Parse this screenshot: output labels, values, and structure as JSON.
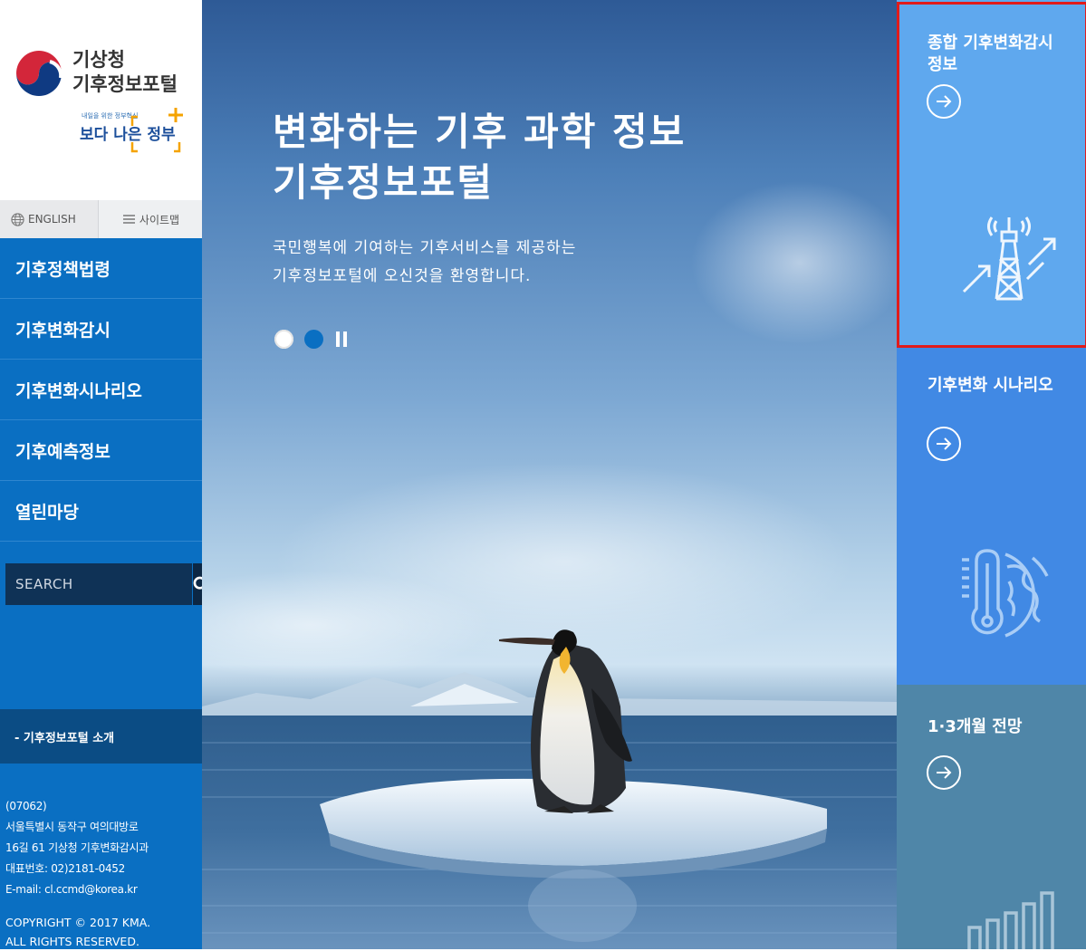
{
  "logo": {
    "line1": "기상청",
    "line2": "기후정보포털",
    "gov_small": "내일을 위한 정부혁신",
    "gov_main": "보다 나은 정부"
  },
  "util": {
    "english": "ENGLISH",
    "sitemap": "사이트맵"
  },
  "nav": {
    "items": [
      {
        "label": "기후정책법령"
      },
      {
        "label": "기후변화감시"
      },
      {
        "label": "기후변화시나리오"
      },
      {
        "label": "기후예측정보"
      },
      {
        "label": "열린마당"
      }
    ]
  },
  "search": {
    "placeholder": "SEARCH"
  },
  "intro": {
    "label": "- 기후정보포털 소개"
  },
  "footer": {
    "postal": "(07062)",
    "addr1": "서울특별시 동작구 여의대방로",
    "addr2": "16길 61 기상청 기후변화감시과",
    "phone": "대표번호: 02)2181-0452",
    "email": "E-mail: cl.ccmd@korea.kr",
    "copy1": "COPYRIGHT © 2017 KMA.",
    "copy2": "ALL RIGHTS RESERVED."
  },
  "hero": {
    "title1": "변화하는 기후 과학 정보",
    "title2": "기후정보포털",
    "sub1": "국민행복에 기여하는 기후서비스를 제공하는",
    "sub2": "기후정보포털에 오신것을 환영합니다."
  },
  "panels": [
    {
      "title": "종합 기후변화감시정보",
      "color": "#5fa8ee"
    },
    {
      "title": "기후변화 시나리오",
      "color": "#4189e4"
    },
    {
      "title": "1·3개월 전망",
      "color": "#4f86a8"
    }
  ],
  "colors": {
    "sidebar": "#0a6fc2",
    "highlight": "#e11b1b"
  }
}
